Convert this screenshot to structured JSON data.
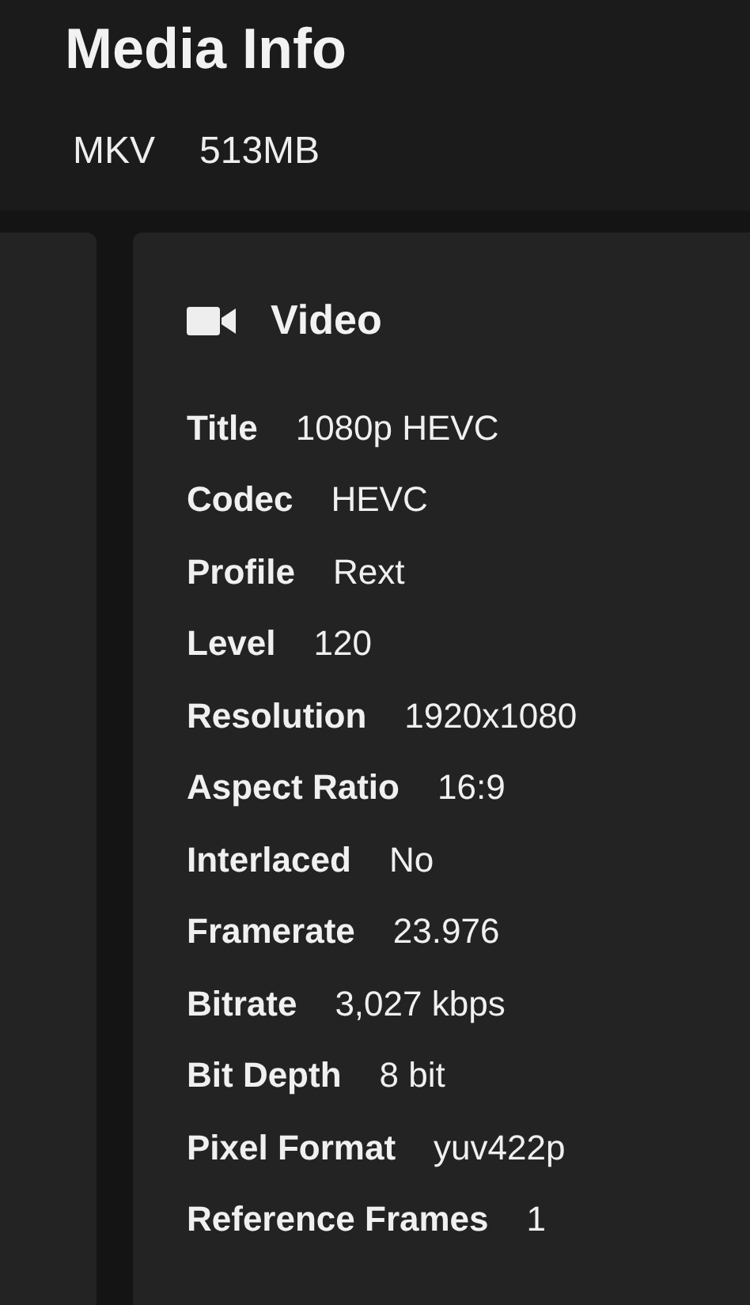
{
  "header": {
    "title": "Media Info",
    "tags": [
      "MKV",
      "513MB"
    ]
  },
  "section": {
    "title": "Video",
    "rows": [
      {
        "label": "Title",
        "value": "1080p HEVC"
      },
      {
        "label": "Codec",
        "value": "HEVC"
      },
      {
        "label": "Profile",
        "value": "Rext"
      },
      {
        "label": "Level",
        "value": "120"
      },
      {
        "label": "Resolution",
        "value": "1920x1080"
      },
      {
        "label": "Aspect Ratio",
        "value": "16:9"
      },
      {
        "label": "Interlaced",
        "value": "No"
      },
      {
        "label": "Framerate",
        "value": "23.976"
      },
      {
        "label": "Bitrate",
        "value": "3,027 kbps"
      },
      {
        "label": "Bit Depth",
        "value": "8 bit"
      },
      {
        "label": "Pixel Format",
        "value": "yuv422p"
      },
      {
        "label": "Reference Frames",
        "value": "1"
      }
    ]
  }
}
